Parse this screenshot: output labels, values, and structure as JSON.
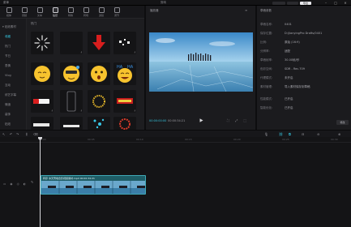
{
  "titlebar": {
    "menu": "菜单",
    "title": "剪映",
    "pill_a": "",
    "pill_b": "",
    "pill_c": "导出",
    "minimize": "–",
    "maximize": "□",
    "close": "✕"
  },
  "media": {
    "tabs": [
      {
        "label": "媒体"
      },
      {
        "label": "音频"
      },
      {
        "label": "文本"
      },
      {
        "label": "贴纸"
      },
      {
        "label": "特效"
      },
      {
        "label": "转场"
      },
      {
        "label": "滤镜"
      },
      {
        "label": "调节"
      }
    ],
    "nav": [
      {
        "label": "▾ 贴纸素材"
      },
      {
        "label": "收藏"
      },
      {
        "label": "热门"
      },
      {
        "label": "节日"
      },
      {
        "label": "表情"
      },
      {
        "label": "Vlog"
      },
      {
        "label": "互动"
      },
      {
        "label": "综艺字幕"
      },
      {
        "label": "情绪"
      },
      {
        "label": "装饰"
      },
      {
        "label": "贴纸"
      },
      {
        "label": "动物"
      }
    ],
    "grid_label": "热门",
    "download_glyph": "⤓"
  },
  "player": {
    "title": "播放器",
    "menu_icon": "≡",
    "time_current": "00:00:00:00",
    "time_total": "00:00:34:21",
    "right_icons": "⛶ ⤢ ⬚"
  },
  "details": {
    "title": "草稿参数",
    "rows": [
      {
        "key": "草稿名称:",
        "value": "0401"
      },
      {
        "key": "保存位置:",
        "value": "D:/JianyingPro Drafts/0401"
      },
      {
        "key": "比例:",
        "value": "原始 (16:9)"
      },
      {
        "key": "分辨率:",
        "value": "适配"
      },
      {
        "key": "草稿帧率:",
        "value": "30.00帧/秒"
      },
      {
        "key": "色彩空间:",
        "value": "SDR - Rec.709"
      },
      {
        "key": "代理模式:",
        "value": "未开启"
      },
      {
        "key": "素材管理:",
        "value": "导入素材保存到草稿"
      },
      {
        "key": "性能模式:",
        "value": "已开启"
      },
      {
        "key": "智能优化:",
        "value": "已开启"
      }
    ],
    "edit_label": "修改"
  },
  "toolbar": {
    "select": "↖",
    "undo": "↶",
    "redo": "↷",
    "split": "⫼",
    "delete": "⌫",
    "mic": "🎙",
    "link": "⛓",
    "snap": "⧉",
    "preview_axis": "⊟",
    "zoom_out": "⊖",
    "zoom_in": "⊕"
  },
  "timeline": {
    "ruler": [
      "00:00",
      "00:05",
      "00:10",
      "00:15",
      "00:20",
      "00:25",
      "00:30",
      "00:35"
    ],
    "track_controls": "▭ ◉ ◎ ◐",
    "cover_label": "✎",
    "clip_label": "转存 冰天雪地合影视频素材.mp4  00:00:34:21"
  },
  "colors": {
    "accent": "#36c6e0",
    "clip": "#1e5d66",
    "panel": "#1d1d20",
    "bg": "#0d0d0f"
  }
}
